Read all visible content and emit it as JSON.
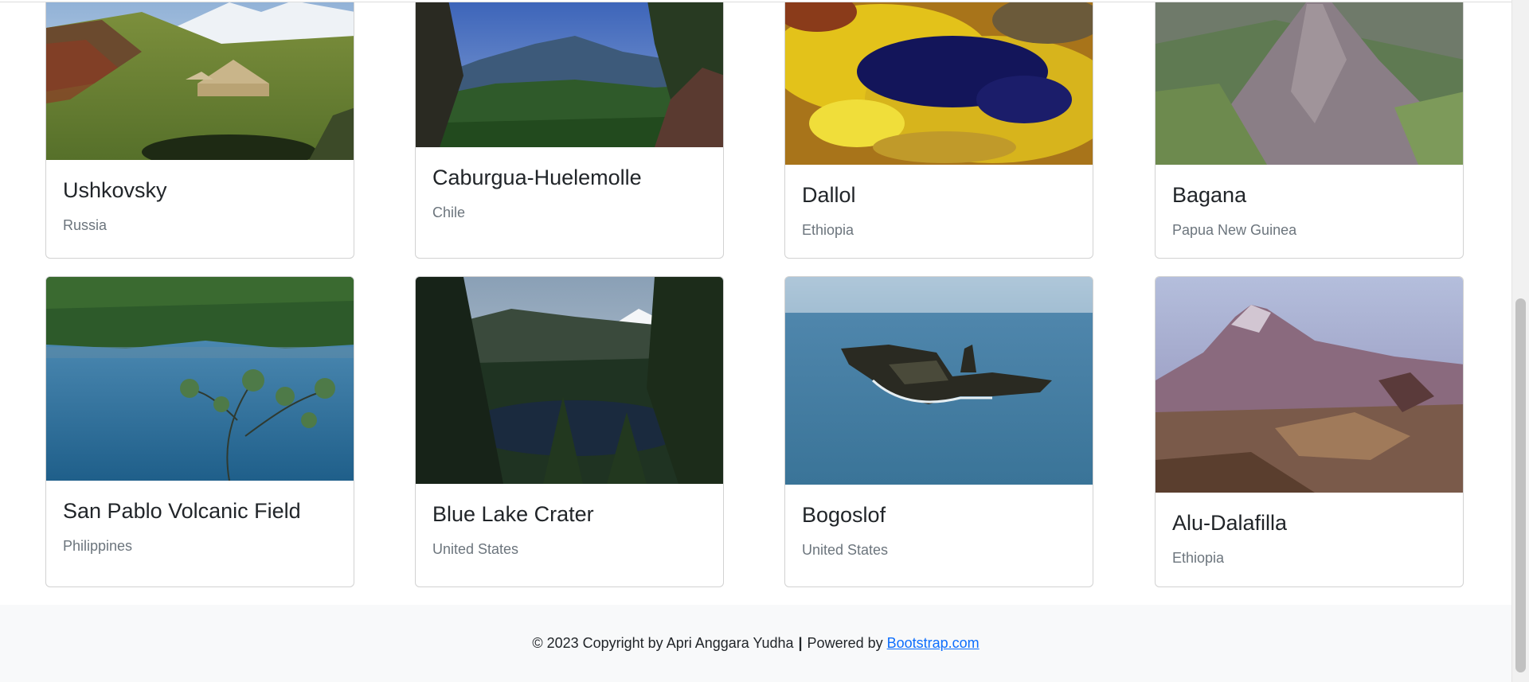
{
  "cards": [
    {
      "title": "Ushkovsky",
      "country": "Russia"
    },
    {
      "title": "Caburgua-Huelemolle",
      "country": "Chile"
    },
    {
      "title": "Dallol",
      "country": "Ethiopia"
    },
    {
      "title": "Bagana",
      "country": "Papua New Guinea"
    },
    {
      "title": "San Pablo Volcanic Field",
      "country": "Philippines"
    },
    {
      "title": "Blue Lake Crater",
      "country": "United States"
    },
    {
      "title": "Bogoslof",
      "country": "United States"
    },
    {
      "title": "Alu-Dalafilla",
      "country": "Ethiopia"
    }
  ],
  "footer": {
    "copyright": "© 2023 Copyright by Apri Anggara Yudha",
    "separator": "|",
    "powered_by": "Powered by",
    "link_text": "Bootstrap.com"
  }
}
